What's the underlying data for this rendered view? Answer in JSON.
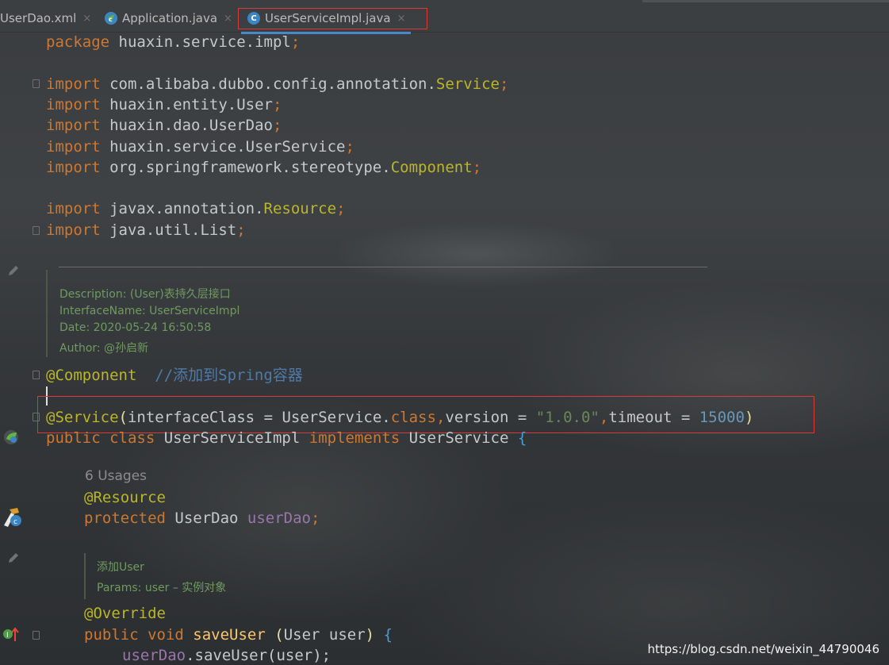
{
  "tabs": [
    {
      "label": "UserDao.xml",
      "close": "×"
    },
    {
      "label": "Application.java",
      "close": "×"
    },
    {
      "label": "UserServiceImpl.java",
      "close": "×",
      "icon_letter": "C"
    }
  ],
  "code": {
    "package_kw": "package",
    "package_name": " huaxin.service.impl",
    ";": ";",
    "imports": [
      {
        "kw": "import",
        "path": " com.alibaba.dubbo.config.annotation.",
        "cls": "Service",
        "end": ";"
      },
      {
        "kw": "import",
        "path": " huaxin.entity.User",
        "cls": "",
        "end": ";"
      },
      {
        "kw": "import",
        "path": " huaxin.dao.UserDao",
        "cls": "",
        "end": ";"
      },
      {
        "kw": "import",
        "path": " huaxin.service.UserService",
        "cls": "",
        "end": ";"
      },
      {
        "kw": "import",
        "path": " org.springframework.stereotype.",
        "cls": "Component",
        "end": ";"
      },
      {
        "kw": "import",
        "path": " javax.annotation.",
        "cls": "Resource",
        "end": ";"
      },
      {
        "kw": "import",
        "path": " java.util.List",
        "cls": "",
        "end": ";"
      }
    ],
    "javadoc_class": [
      "Description: (User)表持久层接口",
      "InterfaceName: UserServiceImpl",
      "Date: 2020-05-24 16:50:58",
      "Author: @孙启新"
    ],
    "component_ann": "@Component",
    "component_cmt": "  //添加到Spring容器",
    "service_ann": "@Service",
    "service_args": {
      "p_open": "(",
      "k1": "interfaceClass",
      " eq1": " = ",
      "v1": "UserService.",
      "v1kw": "class",
      "c1": ",",
      "k2": "version",
      "eq2": " = ",
      "v2": "\"1.0.0\"",
      "c2": ",",
      "k3": "timeout",
      "eq3": " = ",
      "v3": "15000",
      "p_close": ")"
    },
    "class_decl": {
      "kw1": "public",
      "kw2": " class ",
      "name": "UserServiceImpl ",
      "kw3": "implements",
      "iface": " UserService ",
      "brace": "{"
    },
    "usages": "6 Usages",
    "resource_ann": "@Resource",
    "field": {
      "kw": "protected",
      "type": " UserDao ",
      "name": "userDao",
      "end": ";"
    },
    "javadoc_method": [
      "添加User",
      "Params:  user – 实例对象"
    ],
    "override_ann": "@Override",
    "method": {
      "kw1": "public",
      "kw2": " void ",
      "name": "saveUser",
      "sp": " ",
      "p1": "(",
      "ptype": "User ",
      "pname": "user",
      "p2": ")",
      "brace": " {"
    },
    "body": {
      "field": "userDao",
      "call": ".saveUser(user);"
    }
  },
  "watermark": "https://blog.csdn.net/weixin_44790046",
  "colors": {
    "keyword": "#cc7832",
    "annotation": "#bbb529",
    "string": "#6a8759",
    "number": "#6897bb",
    "field": "#9876aa",
    "highlight_box": "#d83a3a"
  }
}
